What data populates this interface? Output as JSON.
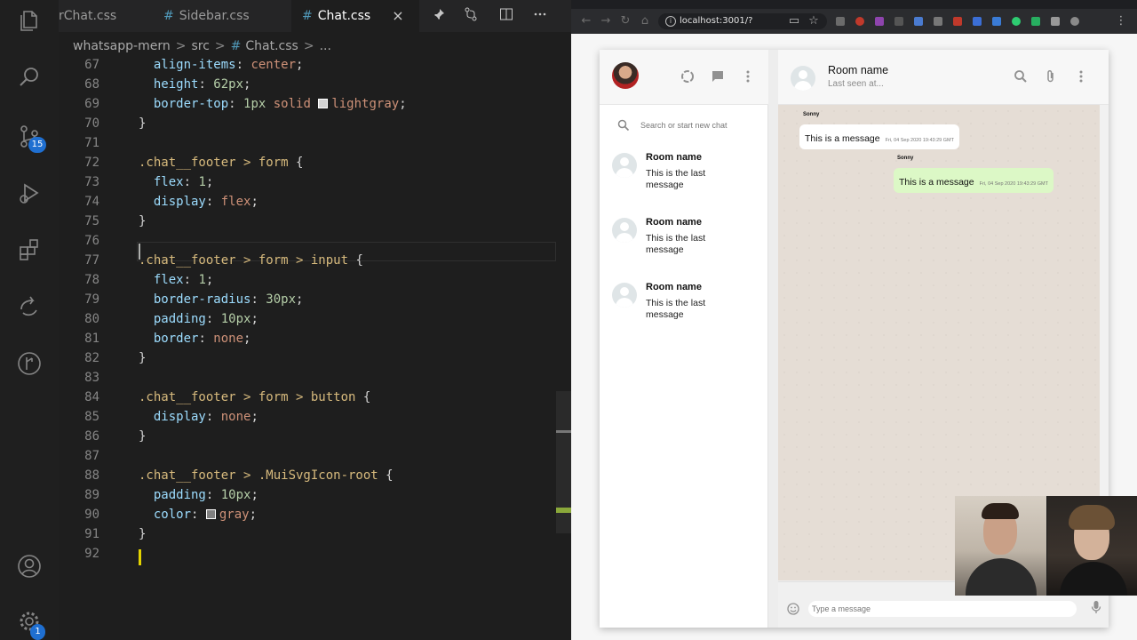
{
  "vscode": {
    "tabs": [
      {
        "label": "rChat.css",
        "active": false
      },
      {
        "label": "Sidebar.css",
        "active": false
      },
      {
        "label": "Chat.css",
        "active": true
      }
    ],
    "tab_close": "×",
    "breadcrumb": [
      "whatsapp-mern",
      "src",
      "Chat.css",
      "..."
    ],
    "activity_badges": {
      "source_control": "15",
      "settings": "1"
    },
    "code_lines": [
      {
        "n": "67",
        "tokens": [
          {
            "t": "  ",
            "c": "punc"
          },
          {
            "t": "align-items",
            "c": "prop"
          },
          {
            "t": ": ",
            "c": "punc"
          },
          {
            "t": "center",
            "c": "val"
          },
          {
            "t": ";",
            "c": "punc"
          }
        ]
      },
      {
        "n": "68",
        "tokens": [
          {
            "t": "  ",
            "c": "punc"
          },
          {
            "t": "height",
            "c": "prop"
          },
          {
            "t": ": ",
            "c": "punc"
          },
          {
            "t": "62px",
            "c": "num"
          },
          {
            "t": ";",
            "c": "punc"
          }
        ]
      },
      {
        "n": "69",
        "tokens": [
          {
            "t": "  ",
            "c": "punc"
          },
          {
            "t": "border-top",
            "c": "prop"
          },
          {
            "t": ": ",
            "c": "punc"
          },
          {
            "t": "1px",
            "c": "num"
          },
          {
            "t": " solid ",
            "c": "val"
          },
          {
            "t": "swatch:#d3d3d3",
            "c": "swatch"
          },
          {
            "t": "lightgray",
            "c": "val"
          },
          {
            "t": ";",
            "c": "punc"
          }
        ]
      },
      {
        "n": "70",
        "tokens": [
          {
            "t": "}",
            "c": "punc"
          }
        ]
      },
      {
        "n": "71",
        "tokens": []
      },
      {
        "n": "72",
        "tokens": [
          {
            "t": ".chat__footer > form",
            "c": "sel"
          },
          {
            "t": " {",
            "c": "punc"
          }
        ]
      },
      {
        "n": "73",
        "tokens": [
          {
            "t": "  ",
            "c": "punc"
          },
          {
            "t": "flex",
            "c": "prop"
          },
          {
            "t": ": ",
            "c": "punc"
          },
          {
            "t": "1",
            "c": "num"
          },
          {
            "t": ";",
            "c": "punc"
          }
        ]
      },
      {
        "n": "74",
        "tokens": [
          {
            "t": "  ",
            "c": "punc"
          },
          {
            "t": "display",
            "c": "prop"
          },
          {
            "t": ": ",
            "c": "punc"
          },
          {
            "t": "flex",
            "c": "val"
          },
          {
            "t": ";",
            "c": "punc"
          }
        ]
      },
      {
        "n": "75",
        "tokens": [
          {
            "t": "}",
            "c": "punc"
          }
        ]
      },
      {
        "n": "76",
        "tokens": []
      },
      {
        "n": "77",
        "tokens": [
          {
            "t": ".chat__footer > form > input",
            "c": "sel"
          },
          {
            "t": " {",
            "c": "punc"
          }
        ]
      },
      {
        "n": "78",
        "tokens": [
          {
            "t": "  ",
            "c": "punc"
          },
          {
            "t": "flex",
            "c": "prop"
          },
          {
            "t": ": ",
            "c": "punc"
          },
          {
            "t": "1",
            "c": "num"
          },
          {
            "t": ";",
            "c": "punc"
          }
        ]
      },
      {
        "n": "79",
        "tokens": [
          {
            "t": "  ",
            "c": "punc"
          },
          {
            "t": "border-radius",
            "c": "prop"
          },
          {
            "t": ": ",
            "c": "punc"
          },
          {
            "t": "30px",
            "c": "num"
          },
          {
            "t": ";",
            "c": "punc"
          }
        ]
      },
      {
        "n": "80",
        "tokens": [
          {
            "t": "  ",
            "c": "punc"
          },
          {
            "t": "padding",
            "c": "prop"
          },
          {
            "t": ": ",
            "c": "punc"
          },
          {
            "t": "10px",
            "c": "num"
          },
          {
            "t": ";",
            "c": "punc"
          }
        ]
      },
      {
        "n": "81",
        "tokens": [
          {
            "t": "  ",
            "c": "punc"
          },
          {
            "t": "border",
            "c": "prop"
          },
          {
            "t": ": ",
            "c": "punc"
          },
          {
            "t": "none",
            "c": "val"
          },
          {
            "t": ";",
            "c": "punc"
          }
        ]
      },
      {
        "n": "82",
        "tokens": [
          {
            "t": "}",
            "c": "punc"
          }
        ]
      },
      {
        "n": "83",
        "tokens": []
      },
      {
        "n": "84",
        "tokens": [
          {
            "t": ".chat__footer > form > button",
            "c": "sel"
          },
          {
            "t": " {",
            "c": "punc"
          }
        ]
      },
      {
        "n": "85",
        "tokens": [
          {
            "t": "  ",
            "c": "punc"
          },
          {
            "t": "display",
            "c": "prop"
          },
          {
            "t": ": ",
            "c": "punc"
          },
          {
            "t": "none",
            "c": "val"
          },
          {
            "t": ";",
            "c": "punc"
          }
        ]
      },
      {
        "n": "86",
        "tokens": [
          {
            "t": "}",
            "c": "punc"
          }
        ]
      },
      {
        "n": "87",
        "tokens": []
      },
      {
        "n": "88",
        "tokens": [
          {
            "t": ".chat__footer > .MuiSvgIcon-root",
            "c": "sel"
          },
          {
            "t": " {",
            "c": "punc"
          }
        ]
      },
      {
        "n": "89",
        "tokens": [
          {
            "t": "  ",
            "c": "punc"
          },
          {
            "t": "padding",
            "c": "prop"
          },
          {
            "t": ": ",
            "c": "punc"
          },
          {
            "t": "10px",
            "c": "num"
          },
          {
            "t": ";",
            "c": "punc"
          }
        ]
      },
      {
        "n": "90",
        "tokens": [
          {
            "t": "  ",
            "c": "punc"
          },
          {
            "t": "color",
            "c": "prop"
          },
          {
            "t": ": ",
            "c": "punc"
          },
          {
            "t": "swatch:#808080",
            "c": "swatch"
          },
          {
            "t": "gray",
            "c": "val"
          },
          {
            "t": ";",
            "c": "punc"
          }
        ]
      },
      {
        "n": "91",
        "tokens": [
          {
            "t": "}",
            "c": "punc"
          }
        ]
      },
      {
        "n": "92",
        "tokens": []
      }
    ]
  },
  "browser": {
    "url": "localhost:3001/?"
  },
  "whatsapp": {
    "search_placeholder": "Search or start new chat",
    "chats": [
      {
        "name": "Room name",
        "last_message": "This is the last message"
      },
      {
        "name": "Room name",
        "last_message": "This is the last message"
      },
      {
        "name": "Room name",
        "last_message": "This is the last message"
      }
    ],
    "header": {
      "title": "Room name",
      "subtitle": "Last seen at..."
    },
    "messages": [
      {
        "name": "Sonny",
        "text": "This is a message",
        "timestamp": "Fri, 04 Sep 2020 19:43:29 GMT",
        "sent": false
      },
      {
        "name": "Sonny",
        "text": "This is a message",
        "timestamp": "Fri, 04 Sep 2020 19:43:29 GMT",
        "sent": true
      }
    ],
    "input_placeholder": "Type a message"
  }
}
